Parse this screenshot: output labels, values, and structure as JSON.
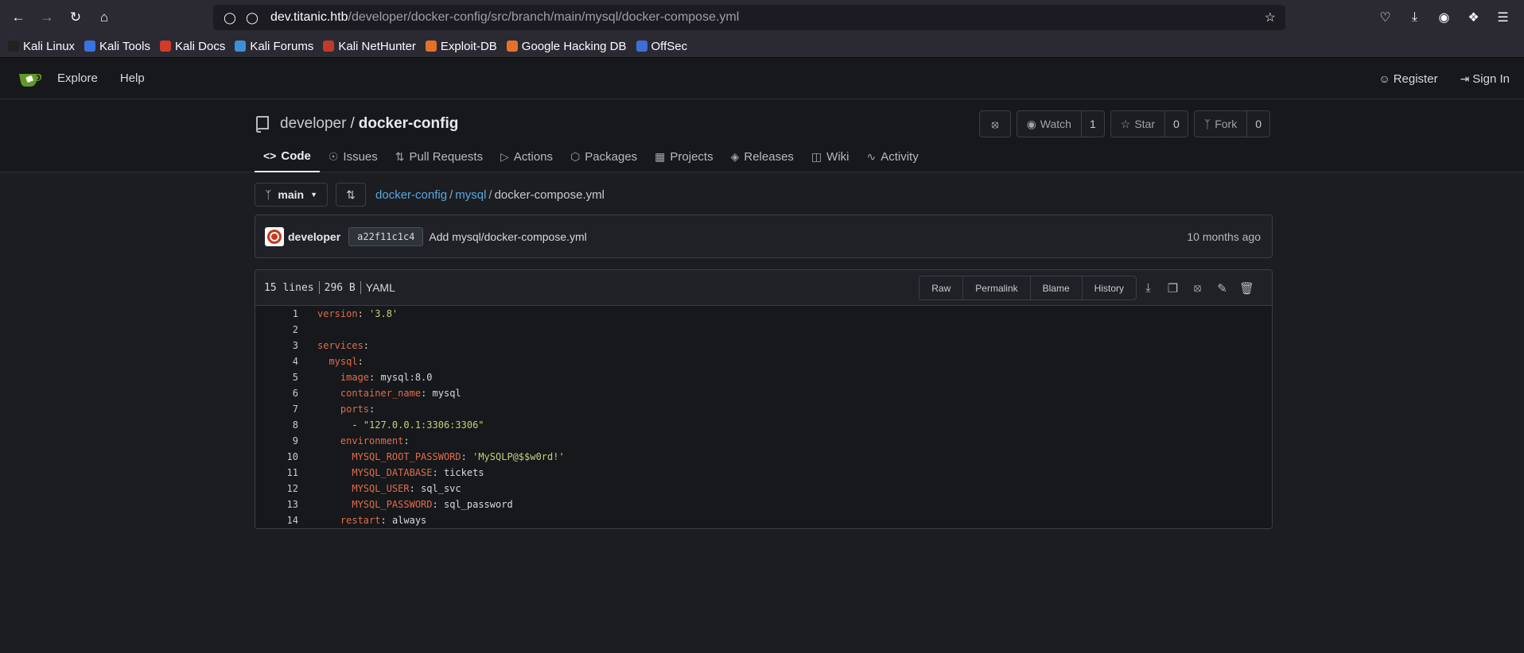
{
  "browser": {
    "url_host": "dev.titanic.htb",
    "url_path": "/developer/docker-config/src/branch/main/mysql/docker-compose.yml",
    "bookmarks": [
      {
        "label": "Kali Linux",
        "color": "#222"
      },
      {
        "label": "Kali Tools",
        "color": "#3873e0"
      },
      {
        "label": "Kali Docs",
        "color": "#d23b2b"
      },
      {
        "label": "Kali Forums",
        "color": "#3f8fd6"
      },
      {
        "label": "Kali NetHunter",
        "color": "#c0392b"
      },
      {
        "label": "Exploit-DB",
        "color": "#e6702a"
      },
      {
        "label": "Google Hacking DB",
        "color": "#e6702a"
      },
      {
        "label": "OffSec",
        "color": "#3f6fd6"
      }
    ]
  },
  "nav": {
    "explore": "Explore",
    "help": "Help",
    "register": "Register",
    "sign_in": "Sign In"
  },
  "repo": {
    "owner": "developer",
    "separator": "/",
    "name": "docker-config",
    "watch_label": "Watch",
    "watch_count": "1",
    "star_label": "Star",
    "star_count": "0",
    "fork_label": "Fork",
    "fork_count": "0"
  },
  "tabs": [
    {
      "label": "Code",
      "icon": "code-icon"
    },
    {
      "label": "Issues",
      "icon": "issue-icon"
    },
    {
      "label": "Pull Requests",
      "icon": "pull-request-icon"
    },
    {
      "label": "Actions",
      "icon": "play-icon"
    },
    {
      "label": "Packages",
      "icon": "package-icon"
    },
    {
      "label": "Projects",
      "icon": "project-icon"
    },
    {
      "label": "Releases",
      "icon": "tag-icon"
    },
    {
      "label": "Wiki",
      "icon": "book-icon"
    },
    {
      "label": "Activity",
      "icon": "pulse-icon"
    }
  ],
  "branch": {
    "name": "main"
  },
  "breadcrumb": {
    "root": "docker-config",
    "folder": "mysql",
    "file": "docker-compose.yml",
    "sep": "/"
  },
  "commit": {
    "author": "developer",
    "sha": "a22f11c1c4",
    "message": "Add mysql/docker-compose.yml",
    "time": "10 months ago"
  },
  "file": {
    "lines": "15 lines",
    "size": "296 B",
    "language": "YAML",
    "buttons": [
      "Raw",
      "Permalink",
      "Blame",
      "History"
    ]
  },
  "code_lines": [
    {
      "num": "1",
      "indent": "",
      "key": "version",
      "sep": ": ",
      "value": "'3.8'",
      "vtype": "s"
    },
    {
      "num": "2",
      "indent": "",
      "key": "",
      "sep": "",
      "value": "",
      "vtype": "p"
    },
    {
      "num": "3",
      "indent": "",
      "key": "services",
      "sep": ":",
      "value": "",
      "vtype": "p"
    },
    {
      "num": "4",
      "indent": "  ",
      "key": "mysql",
      "sep": ":",
      "value": "",
      "vtype": "p"
    },
    {
      "num": "5",
      "indent": "    ",
      "key": "image",
      "sep": ": ",
      "value": "mysql:8.0",
      "vtype": "p"
    },
    {
      "num": "6",
      "indent": "    ",
      "key": "container_name",
      "sep": ": ",
      "value": "mysql",
      "vtype": "p"
    },
    {
      "num": "7",
      "indent": "    ",
      "key": "ports",
      "sep": ":",
      "value": "",
      "vtype": "p"
    },
    {
      "num": "8",
      "indent": "      ",
      "key": "",
      "sep": "- ",
      "value": "\"127.0.0.1:3306:3306\"",
      "vtype": "s"
    },
    {
      "num": "9",
      "indent": "    ",
      "key": "environment",
      "sep": ":",
      "value": "",
      "vtype": "p"
    },
    {
      "num": "10",
      "indent": "      ",
      "key": "MYSQL_ROOT_PASSWORD",
      "sep": ": ",
      "value": "'MySQLP@$$w0rd!'",
      "vtype": "s"
    },
    {
      "num": "11",
      "indent": "      ",
      "key": "MYSQL_DATABASE",
      "sep": ": ",
      "value": "tickets",
      "vtype": "p"
    },
    {
      "num": "12",
      "indent": "      ",
      "key": "MYSQL_USER",
      "sep": ": ",
      "value": "sql_svc",
      "vtype": "p"
    },
    {
      "num": "13",
      "indent": "      ",
      "key": "MYSQL_PASSWORD",
      "sep": ": ",
      "value": "sql_password",
      "vtype": "p"
    },
    {
      "num": "14",
      "indent": "    ",
      "key": "restart",
      "sep": ": ",
      "value": "always",
      "vtype": "p"
    }
  ]
}
